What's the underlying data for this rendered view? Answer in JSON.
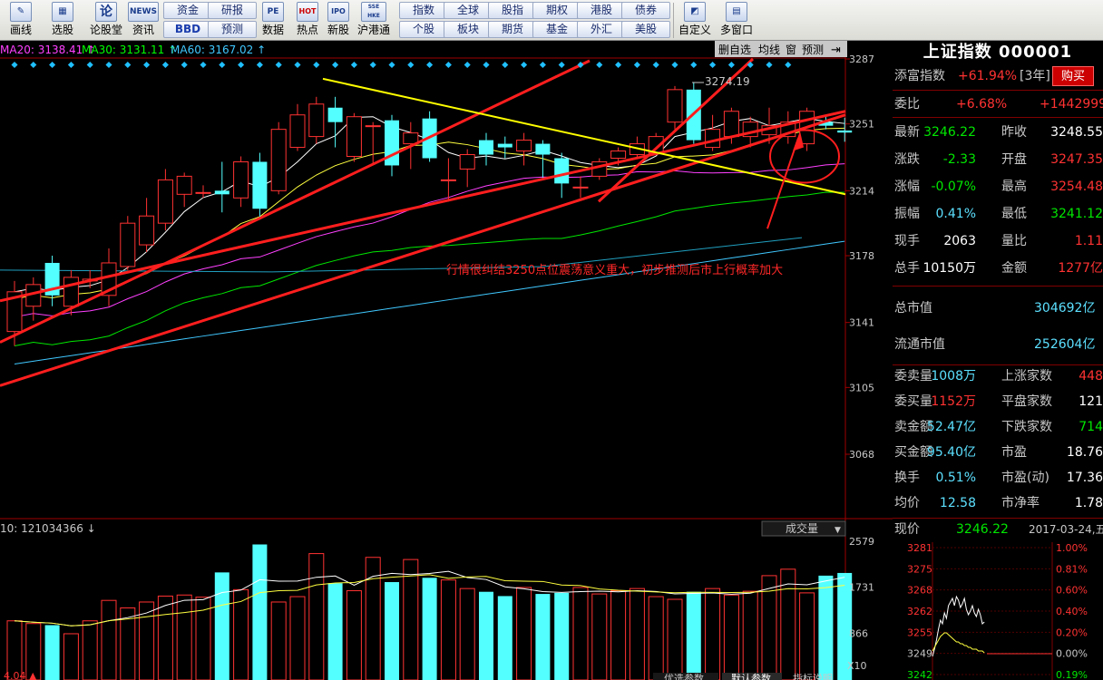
{
  "toolbar": {
    "big_buttons": [
      {
        "label": "画线",
        "icon": "pencil-icon"
      },
      {
        "label": "选股",
        "icon": "screen-icon"
      },
      {
        "label": "论股堂",
        "icon": "forum-icon"
      },
      {
        "label": "资讯",
        "icon": "news-icon"
      },
      {
        "label": "数据",
        "icon": "pe-icon"
      },
      {
        "label": "热点",
        "icon": "hot-icon"
      },
      {
        "label": "新股",
        "icon": "ipo-icon"
      },
      {
        "label": "沪港通",
        "icon": "sse-hkex-icon"
      },
      {
        "label": "自定义",
        "icon": "custom-icon"
      },
      {
        "label": "多窗口",
        "icon": "multi-window-icon"
      }
    ],
    "icon_text": {
      "forum": "论",
      "news": "NEWS",
      "pe": "PE",
      "hot": "HOT",
      "ipo": "IPO",
      "sse": "SSE HKE"
    },
    "small_buttons": [
      {
        "label": "资金"
      },
      {
        "label": "研报"
      },
      {
        "label": "BBD"
      },
      {
        "label": "预测"
      },
      {
        "label": "指数"
      },
      {
        "label": "全球"
      },
      {
        "label": "股指"
      },
      {
        "label": "期权"
      },
      {
        "label": "港股"
      },
      {
        "label": "债券"
      },
      {
        "label": "个股"
      },
      {
        "label": "板块"
      },
      {
        "label": "期货"
      },
      {
        "label": "基金"
      },
      {
        "label": "外汇"
      },
      {
        "label": "美股"
      }
    ]
  },
  "chart_header": {
    "ma20": "MA20: 3138.41 ↑",
    "ma30": "MA30: 3131.11 ↑",
    "ma60": "MA60: 3167.02 ↑",
    "buttons": [
      "删自选",
      "均线",
      "窗",
      "预测"
    ]
  },
  "chart_data": {
    "type": "candlestick",
    "price_ticks": [
      "3287",
      "3251",
      "3214",
      "3178",
      "3141",
      "3105",
      "3068"
    ],
    "volume_ticks": [
      "2579",
      "1731",
      "866"
    ],
    "volume_unit": "X10",
    "max_label": "3274.19",
    "annotation": "行情很纠结3250点位震荡意义重大，初步推测后市上行概率加大",
    "volume_header": "10: 121034366 ↓",
    "volume_selector": "成交量",
    "candles": [
      {
        "o": 3136,
        "c": 3158,
        "h": 3164,
        "l": 3128
      },
      {
        "o": 3150,
        "c": 3162,
        "h": 3166,
        "l": 3142
      },
      {
        "o": 3174,
        "c": 3156,
        "h": 3178,
        "l": 3150
      },
      {
        "o": 3150,
        "c": 3166,
        "h": 3170,
        "l": 3145
      },
      {
        "o": 3164,
        "c": 3165,
        "h": 3170,
        "l": 3160
      },
      {
        "o": 3156,
        "c": 3174,
        "h": 3182,
        "l": 3150
      },
      {
        "o": 3172,
        "c": 3196,
        "h": 3200,
        "l": 3170
      },
      {
        "o": 3184,
        "c": 3200,
        "h": 3210,
        "l": 3180
      },
      {
        "o": 3196,
        "c": 3220,
        "h": 3226,
        "l": 3192
      },
      {
        "o": 3212,
        "c": 3222,
        "h": 3224,
        "l": 3205
      },
      {
        "o": 3213,
        "c": 3213,
        "h": 3217,
        "l": 3210
      },
      {
        "o": 3214,
        "c": 3212,
        "h": 3230,
        "l": 3202
      },
      {
        "o": 3210,
        "c": 3230,
        "h": 3233,
        "l": 3205
      },
      {
        "o": 3230,
        "c": 3204,
        "h": 3235,
        "l": 3198
      },
      {
        "o": 3214,
        "c": 3248,
        "h": 3252,
        "l": 3212
      },
      {
        "o": 3238,
        "c": 3256,
        "h": 3262,
        "l": 3236
      },
      {
        "o": 3244,
        "c": 3262,
        "h": 3266,
        "l": 3240
      },
      {
        "o": 3260,
        "c": 3252,
        "h": 3266,
        "l": 3238
      },
      {
        "o": 3233,
        "c": 3255,
        "h": 3257,
        "l": 3230
      },
      {
        "o": 3250,
        "c": 3250,
        "h": 3252,
        "l": 3228
      },
      {
        "o": 3253,
        "c": 3228,
        "h": 3256,
        "l": 3222
      },
      {
        "o": 3240,
        "c": 3246,
        "h": 3252,
        "l": 3226
      },
      {
        "o": 3254,
        "c": 3232,
        "h": 3258,
        "l": 3230
      },
      {
        "o": 3220,
        "c": 3220,
        "h": 3232,
        "l": 3208
      },
      {
        "o": 3226,
        "c": 3234,
        "h": 3237,
        "l": 3216
      },
      {
        "o": 3242,
        "c": 3234,
        "h": 3246,
        "l": 3228
      },
      {
        "o": 3240,
        "c": 3238,
        "h": 3244,
        "l": 3232
      },
      {
        "o": 3236,
        "c": 3242,
        "h": 3246,
        "l": 3228
      },
      {
        "o": 3240,
        "c": 3234,
        "h": 3242,
        "l": 3220
      },
      {
        "o": 3232,
        "c": 3218,
        "h": 3235,
        "l": 3210
      },
      {
        "o": 3216,
        "c": 3216,
        "h": 3222,
        "l": 3210
      },
      {
        "o": 3222,
        "c": 3230,
        "h": 3232,
        "l": 3220
      },
      {
        "o": 3232,
        "c": 3236,
        "h": 3238,
        "l": 3228
      },
      {
        "o": 3234,
        "c": 3240,
        "h": 3244,
        "l": 3232
      },
      {
        "o": 3235,
        "c": 3244,
        "h": 3246,
        "l": 3234
      },
      {
        "o": 3252,
        "c": 3270,
        "h": 3272,
        "l": 3248
      },
      {
        "o": 3270,
        "c": 3242,
        "h": 3274.19,
        "l": 3240
      },
      {
        "o": 3238,
        "c": 3248,
        "h": 3256,
        "l": 3236
      },
      {
        "o": 3244,
        "c": 3258,
        "h": 3260,
        "l": 3240
      },
      {
        "o": 3244,
        "c": 3252,
        "h": 3255,
        "l": 3238
      },
      {
        "o": 3245,
        "c": 3250,
        "h": 3260,
        "l": 3240
      },
      {
        "o": 3244,
        "c": 3252,
        "h": 3258,
        "l": 3240
      },
      {
        "o": 3240,
        "c": 3258,
        "h": 3260,
        "l": 3236
      },
      {
        "o": 3252,
        "c": 3250,
        "h": 3256,
        "l": 3248
      },
      {
        "o": 3247.35,
        "c": 3246.22,
        "h": 3254.48,
        "l": 3241.12
      }
    ],
    "volumes": [
      1100,
      1050,
      1020,
      860,
      1100,
      1480,
      1340,
      1450,
      1560,
      1580,
      1540,
      2000,
      1680,
      2520,
      1450,
      1550,
      2350,
      1800,
      1660,
      2280,
      1820,
      2240,
      1900,
      1860,
      1700,
      1640,
      1560,
      1720,
      1600,
      1620,
      1720,
      1600,
      1660,
      1700,
      1550,
      1500,
      1640,
      1700,
      1580,
      1650,
      1940,
      2060,
      1620,
      1940,
      1990,
      1560,
      980
    ],
    "ma_lines": [
      "MA5",
      "MA10",
      "MA20",
      "MA30",
      "MA60",
      "MA120"
    ]
  },
  "quote": {
    "title": "上证指数 000001",
    "tianfu_label": "添富指数",
    "tianfu_value": "+61.94%",
    "tianfu_period": "[3年]",
    "buy_button": "购买",
    "weibi_label": "委比",
    "weibi_pct": "+6.68%",
    "weibi_val": "+1442999",
    "rows": [
      {
        "l1": "最新",
        "v1": "3246.22",
        "l2": "昨收",
        "v2": "3248.55"
      },
      {
        "l1": "涨跌",
        "v1": "-2.33",
        "l2": "开盘",
        "v2": "3247.35"
      },
      {
        "l1": "涨幅",
        "v1": "-0.07%",
        "l2": "最高",
        "v2": "3254.48"
      },
      {
        "l1": "振幅",
        "v1": "0.41%",
        "l2": "最低",
        "v2": "3241.12"
      },
      {
        "l1": "现手",
        "v1": "2063",
        "l2": "量比",
        "v2": "1.11"
      },
      {
        "l1": "总手",
        "v1": "10150万",
        "l2": "金额",
        "v2": "1277亿"
      }
    ],
    "total_mv_label": "总市值",
    "total_mv": "304692亿",
    "float_mv_label": "流通市值",
    "float_mv": "252604亿",
    "rows2": [
      {
        "l1": "委卖量",
        "v1": "1008万",
        "l2": "上涨家数",
        "v2": "448"
      },
      {
        "l1": "委买量",
        "v1": "1152万",
        "l2": "平盘家数",
        "v2": "121"
      },
      {
        "l1": "卖金额",
        "v1": "52.47亿",
        "l2": "下跌家数",
        "v2": "714"
      },
      {
        "l1": "买金额",
        "v1": "95.40亿",
        "l2": "市盈",
        "v2": "18.76"
      },
      {
        "l1": "换手",
        "v1": "0.51%",
        "l2": "市盈(动)",
        "v2": "17.36"
      },
      {
        "l1": "均价",
        "v1": "12.58",
        "l2": "市净率",
        "v2": "1.78"
      }
    ],
    "xianjia_label": "现价",
    "xianjia": "3246.22",
    "date": "2017-03-24,五",
    "mini_left": [
      "3281",
      "3275",
      "3268",
      "3262",
      "3255",
      "3249",
      "3242"
    ],
    "mini_right": [
      "1.00%",
      "0.81%",
      "0.60%",
      "0.40%",
      "0.20%",
      "0.00%",
      "0.19%"
    ]
  },
  "bottom_tabs": [
    "优选参数",
    "默认参数",
    "指标说明"
  ],
  "volume_footer_left": "4.04 ▲",
  "colors": {
    "up": "#ff3232",
    "down": "#54ffff",
    "yellow_line": "#ffff00",
    "bg": "#000000"
  }
}
